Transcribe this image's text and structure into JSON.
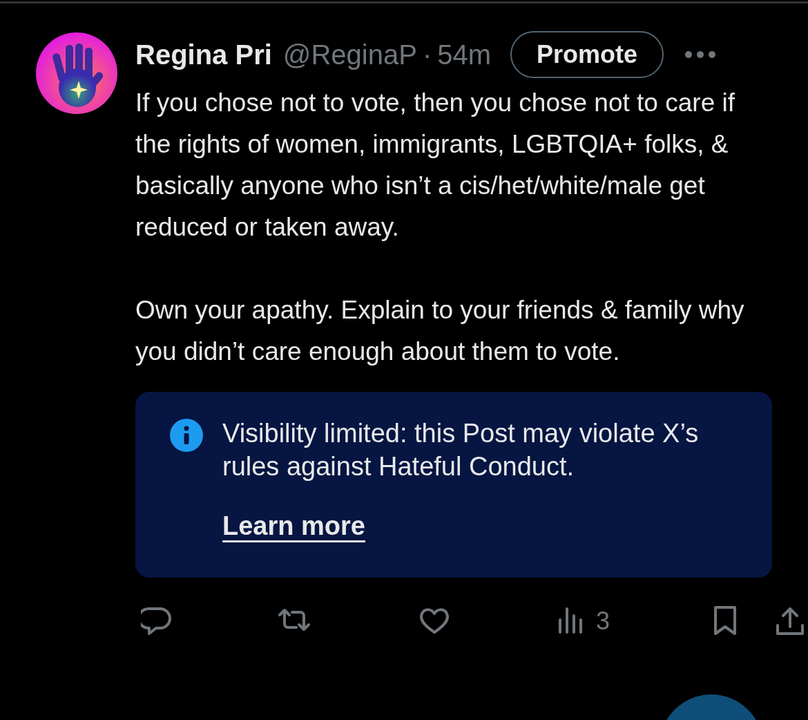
{
  "post": {
    "author_name": "Regina Pri",
    "handle": "@ReginaP",
    "separator": "·",
    "time": "54m",
    "promote_button": "Promote",
    "paragraphs": [
      "If you chose not to vote, then you chose not to care if the rights of women, immigrants, LGBTQIA+ folks, & basically anyone who isn’t a cis/het/white/male get reduced or taken away.",
      "Own your apathy. Explain to your friends & family why you didn’t care enough about them to vote."
    ],
    "notice": {
      "text": "Visibility limited: this Post may violate X’s rules against Hateful Conduct.",
      "link": "Learn more"
    },
    "actions": [
      {
        "kind": "reply"
      },
      {
        "kind": "repost"
      },
      {
        "kind": "like"
      },
      {
        "kind": "views",
        "count": "3"
      },
      {
        "kind": "bookmark"
      },
      {
        "kind": "share"
      }
    ]
  }
}
